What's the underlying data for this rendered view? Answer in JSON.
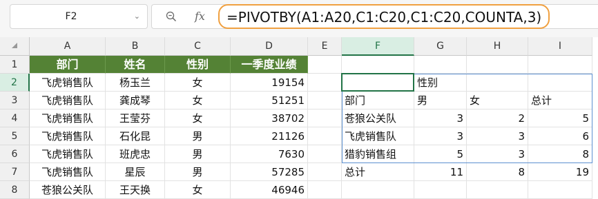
{
  "name_box": {
    "value": "F2"
  },
  "formula_bar": {
    "fx_label": "fx",
    "formula": "=PIVOTBY(A1:A20,C1:C20,C1:C20,COUNTA,3)"
  },
  "columns": [
    "A",
    "B",
    "C",
    "D",
    "E",
    "F",
    "G",
    "H",
    "I"
  ],
  "rows": [
    "1",
    "2",
    "3",
    "4",
    "5",
    "6",
    "7",
    "8"
  ],
  "source_table": {
    "headers": [
      "部门",
      "姓名",
      "性别",
      "一季度业绩"
    ],
    "rows": [
      [
        "飞虎销售队",
        "杨玉兰",
        "女",
        "19154"
      ],
      [
        "飞虎销售队",
        "龚成琴",
        "女",
        "51251"
      ],
      [
        "飞虎销售队",
        "王莹芬",
        "女",
        "38702"
      ],
      [
        "飞虎销售队",
        "石化昆",
        "男",
        "21126"
      ],
      [
        "飞虎销售队",
        "班虎忠",
        "男",
        "7630"
      ],
      [
        "飞虎销售队",
        "星辰",
        "男",
        "57285"
      ],
      [
        "苍狼公关队",
        "王天换",
        "女",
        "46946"
      ]
    ]
  },
  "pivot": {
    "header_row": [
      "",
      "性别",
      "",
      ""
    ],
    "label_row": [
      "部门",
      "男",
      "女",
      "总计"
    ],
    "rows": [
      [
        "苍狼公关队",
        "3",
        "2",
        "5"
      ],
      [
        "飞虎销售队",
        "3",
        "3",
        "6"
      ],
      [
        "猎豹销售组",
        "5",
        "3",
        "8"
      ],
      [
        "总计",
        "11",
        "8",
        "19"
      ]
    ]
  }
}
